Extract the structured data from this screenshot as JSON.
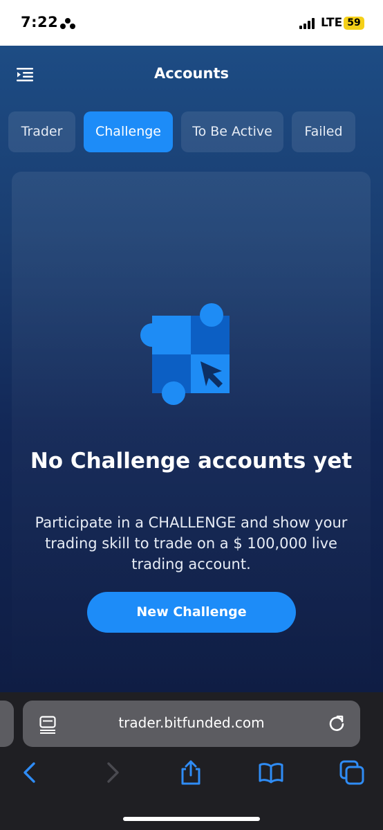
{
  "status_bar": {
    "time": "7:22",
    "network": "LTE",
    "battery": "59"
  },
  "header": {
    "title": "Accounts"
  },
  "tabs": [
    {
      "label": "Trader",
      "active": false
    },
    {
      "label": "Challenge",
      "active": true
    },
    {
      "label": "To Be Active",
      "active": false
    },
    {
      "label": "Failed",
      "active": false
    }
  ],
  "empty_state": {
    "title": "No Challenge accounts yet",
    "description": "Participate in a CHALLENGE and show your trading skill to trade on a $ 100,000 live trading account.",
    "button_label": "New Challenge"
  },
  "browser": {
    "url": "trader.bitfunded.com"
  },
  "colors": {
    "accent": "#1d8cf8",
    "battery": "#f5d018"
  },
  "icons": [
    "menu-icon",
    "challenge-illustration",
    "page-menu-icon",
    "reload-icon",
    "back-icon",
    "forward-icon",
    "share-icon",
    "bookmarks-icon",
    "tabs-icon"
  ]
}
